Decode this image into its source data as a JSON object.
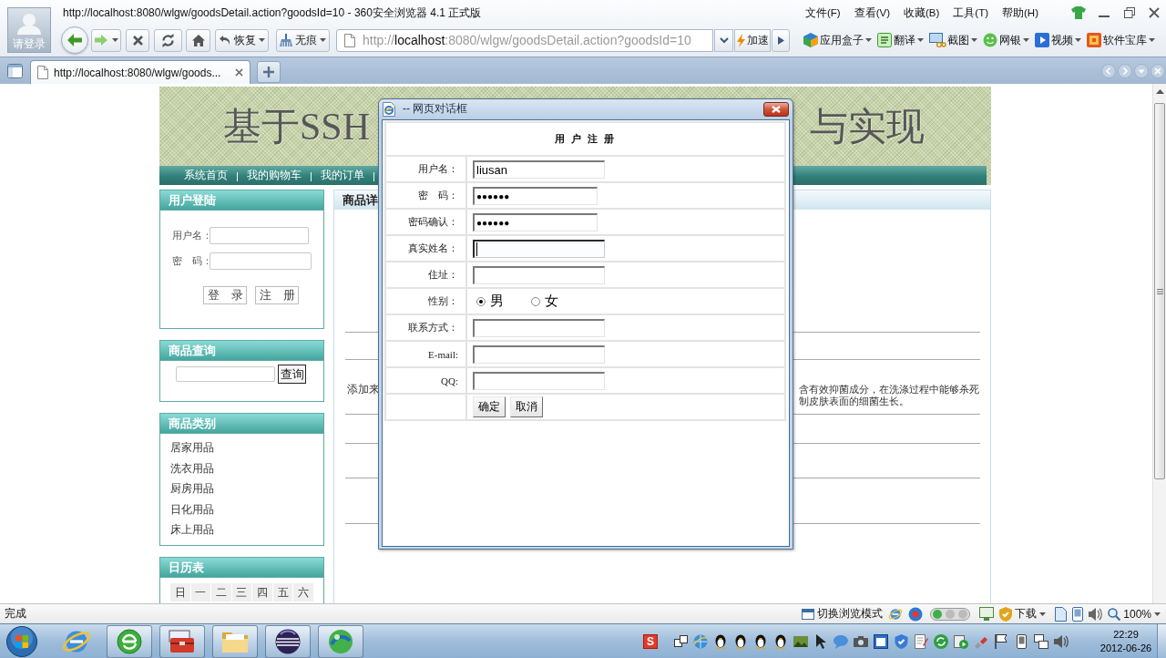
{
  "browser": {
    "title": "http://localhost:8080/wlgw/goodsDetail.action?goodsId=10 - 360安全浏览器 4.1 正式版",
    "avatar_label": "请登录",
    "menu": [
      "文件(F)",
      "查看(V)",
      "收藏(B)",
      "工具(T)",
      "帮助(H)"
    ],
    "toolbar": {
      "restore": "恢复",
      "incognito": "无痕",
      "address": {
        "scheme": "http://",
        "host": "localhost",
        "path": ":8080/wlgw/goodsDetail.action?goodsId=10"
      },
      "speed_up": "加速"
    },
    "extensions": [
      {
        "kind": "appbox",
        "label": "应用盒子"
      },
      {
        "kind": "translate",
        "label": "翻译"
      },
      {
        "kind": "screenshot",
        "label": "截图"
      },
      {
        "kind": "bank",
        "label": "网银"
      },
      {
        "kind": "video",
        "label": "视频"
      },
      {
        "kind": "software",
        "label": "软件宝库"
      }
    ],
    "tabs": [
      {
        "label": "http://localhost:8080/wlgw/goods...",
        "selected": true
      }
    ]
  },
  "page": {
    "banner": {
      "title_left": "基于SSH",
      "title_right": "与实现"
    },
    "nav": [
      {
        "label": "系统首页",
        "separator": "|"
      },
      {
        "label": "我的购物车",
        "separator": "|"
      },
      {
        "label": "我的订单",
        "separator": "|"
      }
    ],
    "login": {
      "title": "用户登陆",
      "username_label": "用户名：",
      "password_label": "密　码：",
      "buttons": [
        "登　录",
        "注　册"
      ]
    },
    "search": {
      "title": "商品查询",
      "button": "查询"
    },
    "categories": {
      "title": "商品类别",
      "items": [
        "居家用品",
        "洗衣用品",
        "厨房用品",
        "日化用品",
        "床上用品"
      ]
    },
    "calendar": {
      "title": "日历表",
      "weekdays": [
        "日",
        "一",
        "二",
        "三",
        "四",
        "五",
        "六"
      ]
    },
    "detail": {
      "title": "商品详",
      "description_left": "添加来",
      "description_right": [
        "含有效抑菌成分，在洗涤过程中能够杀死",
        "制皮肤表面的细菌生长。"
      ]
    }
  },
  "dialog": {
    "title": "-- 网页对话框",
    "heading": "用 户 注 册",
    "rows": [
      {
        "kind": "text",
        "label": "用户名：",
        "value": "liusan",
        "focused": false
      },
      {
        "kind": "password",
        "label": "密　码：",
        "value": "●●●●●●",
        "focused": false
      },
      {
        "kind": "password",
        "label": "密码确认：",
        "value": "●●●●●●",
        "focused": false
      },
      {
        "kind": "text",
        "label": "真实姓名：",
        "focused": true
      },
      {
        "kind": "text",
        "label": "住址：",
        "focused": false
      },
      {
        "kind": "radio",
        "label": "性别：",
        "options": [
          {
            "label": "男",
            "selected": true
          },
          {
            "label": "女",
            "selected": false
          }
        ]
      },
      {
        "kind": "text",
        "label": "联系方式：",
        "focused": false
      },
      {
        "kind": "text",
        "label": "E-mail:",
        "focused": false
      },
      {
        "kind": "text",
        "label": "QQ:",
        "focused": false
      }
    ],
    "buttons": [
      "确定",
      "取消"
    ]
  },
  "status_bar": {
    "text": "完成",
    "view_mode": "切换浏览模式",
    "downloads": "下载",
    "zoom": "100%"
  },
  "taskbar": {
    "ime_label": "S",
    "time": "22:29",
    "date": "2012-06-26"
  }
}
